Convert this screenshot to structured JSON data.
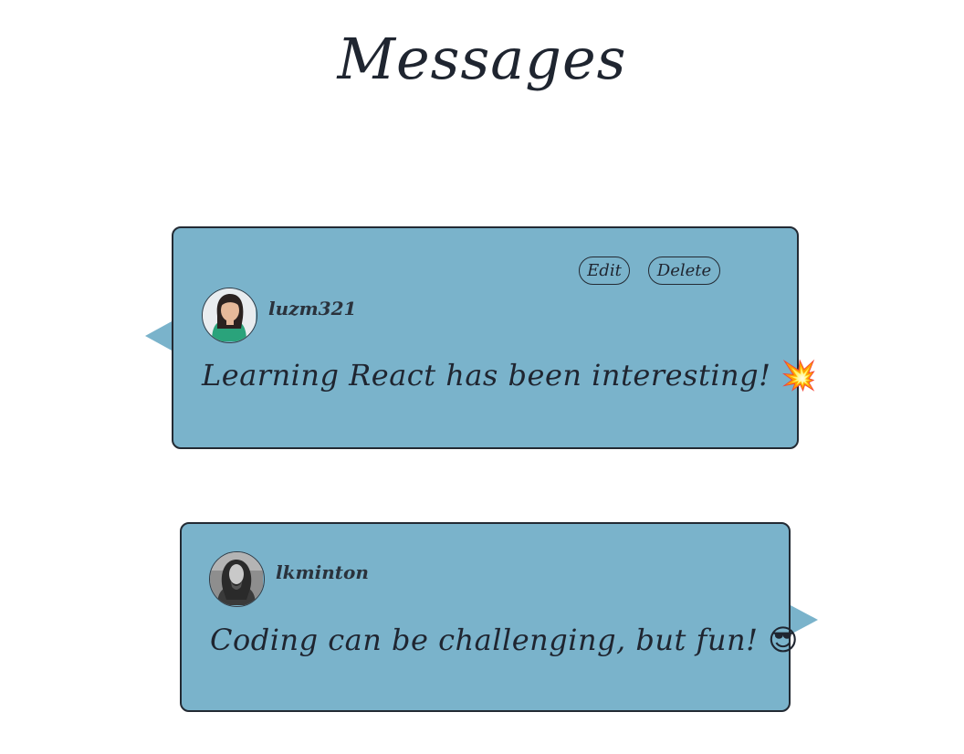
{
  "page": {
    "title": "Messages"
  },
  "messages": [
    {
      "username": "luzm321",
      "text": "Learning React has been interesting!",
      "emoji": "💥",
      "emoji_name": "collision-emoji",
      "actions": {
        "edit_label": "Edit",
        "delete_label": "Delete"
      },
      "bubble_side": "left"
    },
    {
      "username": "lkminton",
      "text": "Coding can be challenging, but fun!",
      "emoji": "😎",
      "emoji_name": "sunglasses-emoji",
      "bubble_side": "right"
    }
  ],
  "colors": {
    "bubble_background": "#7ab3cb",
    "bubble_border": "#232a33",
    "text": "#1f2530"
  }
}
